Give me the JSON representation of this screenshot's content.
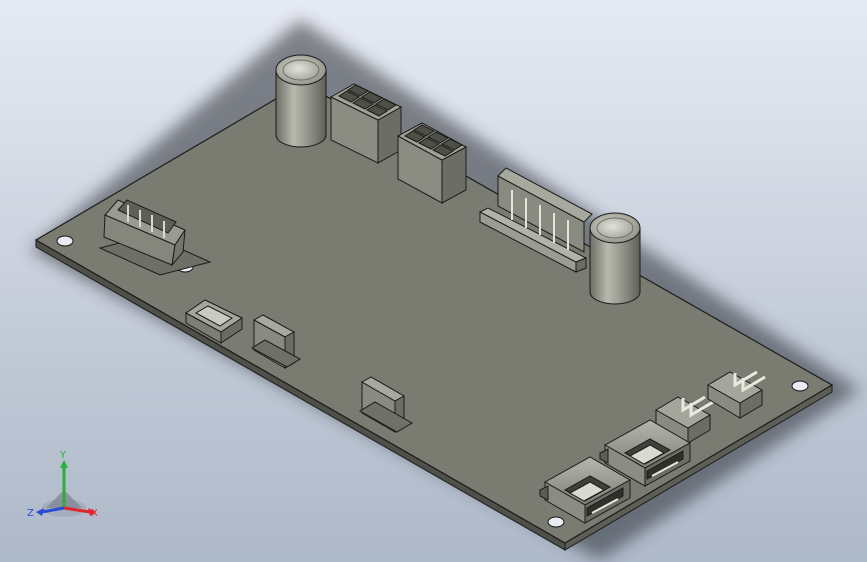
{
  "triad": {
    "x_label": "X",
    "y_label": "Y",
    "z_label": "Z"
  },
  "colors": {
    "background_top": "#e6eaf2",
    "background_bottom": "#aeb9c9",
    "board_top": "#7a7b71",
    "board_edge": "#5a5b53",
    "component": "#8a8b80",
    "outline": "#202020",
    "axis_x": "#e0262b",
    "axis_y": "#27b13c",
    "axis_z": "#2a4bd6"
  },
  "icons": {
    "triad": "coordinate-triad-icon"
  }
}
